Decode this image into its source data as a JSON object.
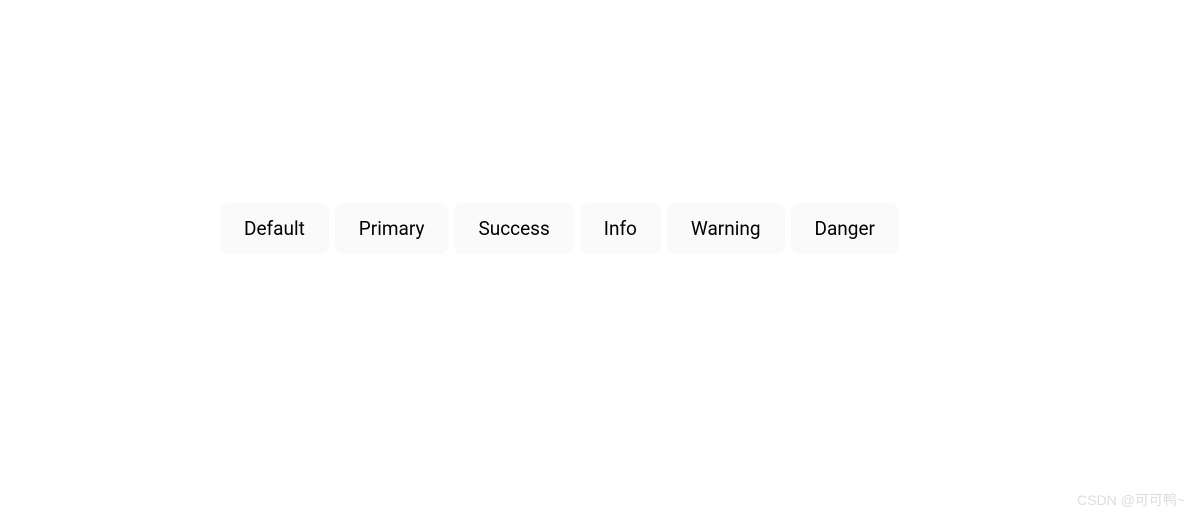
{
  "buttons": {
    "default": {
      "label": "Default"
    },
    "primary": {
      "label": "Primary"
    },
    "success": {
      "label": "Success"
    },
    "info": {
      "label": "Info"
    },
    "warning": {
      "label": "Warning"
    },
    "danger": {
      "label": "Danger"
    }
  },
  "watermark": "CSDN @可可鸭~"
}
